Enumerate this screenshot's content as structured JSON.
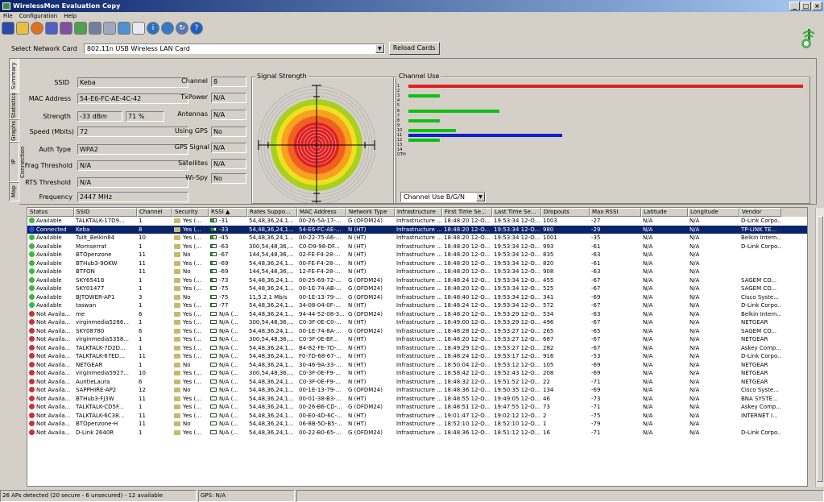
{
  "window": {
    "title": "WirelessMon Evaluation Copy"
  },
  "menu": [
    "File",
    "Configuration",
    "Help"
  ],
  "toolbar_icons": [
    "save-icon",
    "open-folder-icon",
    "record-icon",
    "network-icon",
    "network-alt-icon",
    "card-icon",
    "card-alt-icon",
    "document-icon",
    "filter-icon",
    "page-icon",
    "info-icon",
    "globe-icon",
    "refresh-icon",
    "help-icon"
  ],
  "network": {
    "label": "Select Network Card",
    "value": "802.11n USB Wireless LAN Card",
    "reload": "Reload Cards"
  },
  "side_tabs": [
    "Summary",
    "Statistics",
    "Graphs",
    "IP Connection",
    "Map"
  ],
  "summary": {
    "ssid_label": "SSID",
    "ssid": "Keba",
    "mac_label": "MAC Address",
    "mac": "54-E6-FC-AE-4C-42",
    "strength_label": "Strength",
    "strength_dbm": "-33 dBm",
    "strength_pct": "71 %",
    "speed_label": "Speed (Mbits)",
    "speed": "72",
    "auth_label": "Auth Type",
    "auth": "WPA2",
    "frag_label": "Frag Threshold",
    "frag": "N/A",
    "rts_label": "RTS Threshold",
    "rts": "N/A",
    "freq_label": "Frequency",
    "freq": "2447 MHz",
    "channel_label": "Channel",
    "channel": "8",
    "txpower_label": "TxPower",
    "txpower": "N/A",
    "antennas_label": "Antennas",
    "antennas": "N/A",
    "usinggps_label": "Using GPS",
    "usinggps": "No",
    "gpssignal_label": "GPS Signal",
    "gpssignal": "N/A",
    "satellites_label": "Satellites",
    "satellites": "N/A",
    "wispy_label": "Wi-Spy",
    "wispy": "No"
  },
  "signal": {
    "title": "Signal Strength"
  },
  "channel_use": {
    "title": "Channel Use",
    "select": "Channel Use B/G/N",
    "channels": [
      "1",
      "2",
      "3",
      "4",
      "5",
      "6",
      "7",
      "8",
      "9",
      "10",
      "11",
      "12",
      "13",
      "14",
      "OTH"
    ],
    "values": [
      100,
      0,
      8,
      0,
      0,
      23,
      0,
      8,
      0,
      12,
      39,
      8,
      0,
      0,
      0
    ],
    "colors": [
      "#e02020",
      "#10c010",
      "#10c010",
      "#10c010",
      "#10c010",
      "#10c010",
      "#10c010",
      "#10c010",
      "#10c010",
      "#10c010",
      "#1020d0",
      "#10c010",
      "#10c010",
      "#10c010",
      "#10c010"
    ]
  },
  "table": {
    "columns": [
      "Status",
      "SSID",
      "Channel",
      "Security",
      "RSSI",
      "Rates Suppo...",
      "MAC Address",
      "Network Type",
      "Infrastructure",
      "First Time Se...",
      "Last Time Se...",
      "Dropouts",
      "Max RSSI",
      "Latitude",
      "Longitude",
      "Vendor"
    ],
    "rows": [
      {
        "status": "Available",
        "dot": "#3cb83c",
        "ssid": "TALKTALK-17D9...",
        "ch": "1",
        "sec": "Yes (...",
        "rssi": "-31",
        "fill": 0.6,
        "rates": "54,48,36,24,1...",
        "mac": "00-26-5A-17-...",
        "net": "G (OFDM24)",
        "inf": "Infrastructure ...",
        "first": "18:48:20 12-O...",
        "last": "19:53:34 12-O...",
        "drop": "1003",
        "max": "-27",
        "lat": "N/A",
        "lon": "N/A",
        "vendor": "D-Link Corpo..."
      },
      {
        "status": "Connected",
        "dot": "#2050d0",
        "ssid": "Keba",
        "ch": "8",
        "sec": "Yes (...",
        "rssi": "-33",
        "fill": 0.6,
        "rates": "54,48,36,24,1...",
        "mac": "54-E6-FC-AE-...",
        "net": "N (HT)",
        "inf": "Infrastructure ...",
        "first": "18:48:20 12-O...",
        "last": "19:53:34 12-O...",
        "drop": "980",
        "max": "-29",
        "lat": "N/A",
        "lon": "N/A",
        "vendor": "TP-LINK TE...",
        "sel": true
      },
      {
        "status": "Available",
        "dot": "#3cb83c",
        "ssid": "Tuilt_Belkin84",
        "ch": "10",
        "sec": "Yes (...",
        "rssi": "-45",
        "fill": 0.5,
        "rates": "54,48,36,24,1...",
        "mac": "00-22-75-A6-...",
        "net": "N (HT)",
        "inf": "Infrastructure ...",
        "first": "18:48:20 12-O...",
        "last": "19:53:34 12-O...",
        "drop": "1001",
        "max": "-35",
        "lat": "N/A",
        "lon": "N/A",
        "vendor": "Belkin Intern..."
      },
      {
        "status": "Available",
        "dot": "#3cb83c",
        "ssid": "Mornserrat",
        "ch": "1",
        "sec": "Yes (...",
        "rssi": "-63",
        "fill": 0.3,
        "rates": "300,54,48,36,...",
        "mac": "C0-D9-98-DF...",
        "net": "N (HT)",
        "inf": "Infrastructure ...",
        "first": "18:48:20 12-O...",
        "last": "19:53:34 12-O...",
        "drop": "993",
        "max": "-61",
        "lat": "N/A",
        "lon": "N/A",
        "vendor": "D-Link Corpo..."
      },
      {
        "status": "Available",
        "dot": "#3cb83c",
        "ssid": "BTOpenzone",
        "ch": "11",
        "sec": "No",
        "rssi": "-67",
        "fill": 0.3,
        "rates": "144,54,48,36,...",
        "mac": "02-FE-F4-28-...",
        "net": "N (HT)",
        "inf": "Infrastructure ...",
        "first": "18:48:20 12-O...",
        "last": "19:53:34 12-O...",
        "drop": "835",
        "max": "-63",
        "lat": "N/A",
        "lon": "N/A",
        "vendor": ""
      },
      {
        "status": "Available",
        "dot": "#3cb83c",
        "ssid": "BTHub3-9OKW",
        "ch": "11",
        "sec": "Yes (...",
        "rssi": "-69",
        "fill": 0.3,
        "rates": "54,48,36,24,1...",
        "mac": "00-FE-F4-28-...",
        "net": "N (HT)",
        "inf": "Infrastructure ...",
        "first": "18:48:20 12-O...",
        "last": "19:53:34 12-O...",
        "drop": "820",
        "max": "-61",
        "lat": "N/A",
        "lon": "N/A",
        "vendor": ""
      },
      {
        "status": "Available",
        "dot": "#3cb83c",
        "ssid": "BTFON",
        "ch": "11",
        "sec": "No",
        "rssi": "-69",
        "fill": 0.3,
        "rates": "144,54,48,36,...",
        "mac": "12-FE-F4-28-...",
        "net": "N (HT)",
        "inf": "Infrastructure ...",
        "first": "18:48:20 12-O...",
        "last": "19:53:34 12-O...",
        "drop": "908",
        "max": "-63",
        "lat": "N/A",
        "lon": "N/A",
        "vendor": ""
      },
      {
        "status": "Available",
        "dot": "#3cb83c",
        "ssid": "SKY65418",
        "ch": "1",
        "sec": "Yes (...",
        "rssi": "-73",
        "fill": 0.25,
        "rates": "54,48,36,24,1...",
        "mac": "00-25-69-72-...",
        "net": "G (OFDM24)",
        "inf": "Infrastructure ...",
        "first": "18:48:24 12-O...",
        "last": "19:53:34 12-O...",
        "drop": "455",
        "max": "-67",
        "lat": "N/A",
        "lon": "N/A",
        "vendor": "SAGEM CO..."
      },
      {
        "status": "Available",
        "dot": "#3cb83c",
        "ssid": "SKY01477",
        "ch": "1",
        "sec": "Yes (...",
        "rssi": "-75",
        "fill": 0.2,
        "rates": "54,48,36,24,1...",
        "mac": "00-1E-74-AB-...",
        "net": "G (OFDM24)",
        "inf": "Infrastructure ...",
        "first": "18:48:20 12-O...",
        "last": "19:53:34 12-O...",
        "drop": "525",
        "max": "-67",
        "lat": "N/A",
        "lon": "N/A",
        "vendor": "SAGEM CO..."
      },
      {
        "status": "Available",
        "dot": "#3cb83c",
        "ssid": "BJTOWER-AP1",
        "ch": "3",
        "sec": "No",
        "rssi": "-75",
        "fill": 0.2,
        "rates": "11,5.2,1 Mb/s",
        "mac": "00-1E-13-79-...",
        "net": "G (OFDM24)",
        "inf": "Infrastructure ...",
        "first": "18:48:40 12-O...",
        "last": "19:53:34 12-O...",
        "drop": "341",
        "max": "-69",
        "lat": "N/A",
        "lon": "N/A",
        "vendor": "Cisco Syste..."
      },
      {
        "status": "Available",
        "dot": "#3cb83c",
        "ssid": "taswan",
        "ch": "1",
        "sec": "Yes (...",
        "rssi": "-77",
        "fill": 0.15,
        "rates": "54,48,36,24,1...",
        "mac": "34-08-04-0F-...",
        "net": "N (HT)",
        "inf": "Infrastructure ...",
        "first": "18:48:24 12-O...",
        "last": "19:53:34 12-O...",
        "drop": "572",
        "max": "-67",
        "lat": "N/A",
        "lon": "N/A",
        "vendor": "D-Link Corpo..."
      },
      {
        "status": "Not Availa...",
        "dot": "#d03030",
        "ssid": "me",
        "ch": "6",
        "sec": "Yes (...",
        "rssi": "N/A (...",
        "fill": 0,
        "rates": "54,48,36,24,1...",
        "mac": "94-44-52-08-3...",
        "net": "G (OFDM24)",
        "inf": "Infrastructure ...",
        "first": "18:48:20 12-O...",
        "last": "19:53:29 12-O...",
        "drop": "534",
        "max": "-63",
        "lat": "N/A",
        "lon": "N/A",
        "vendor": "Belkin Intern..."
      },
      {
        "status": "Not Availa...",
        "dot": "#d03030",
        "ssid": "virginmedia5286...",
        "ch": "1",
        "sec": "Yes (...",
        "rssi": "N/A (...",
        "fill": 0,
        "rates": "300,54,48,36,...",
        "mac": "C0-3F-0E-C0-...",
        "net": "N (HT)",
        "inf": "Infrastructure ...",
        "first": "18:49:00 12-O...",
        "last": "19:53:29 12-O...",
        "drop": "496",
        "max": "-67",
        "lat": "N/A",
        "lon": "N/A",
        "vendor": "NETGEAR"
      },
      {
        "status": "Not Availa...",
        "dot": "#d03030",
        "ssid": "SKY08780",
        "ch": "6",
        "sec": "Yes (...",
        "rssi": "N/A (...",
        "fill": 0,
        "rates": "54,48,36,24,1...",
        "mac": "00-1E-74-8A-...",
        "net": "G (OFDM24)",
        "inf": "Infrastructure ...",
        "first": "18:48:28 12-O...",
        "last": "19:53:27 12-O...",
        "drop": "265",
        "max": "-65",
        "lat": "N/A",
        "lon": "N/A",
        "vendor": "SAGEM CO..."
      },
      {
        "status": "Not Availa...",
        "dot": "#d03030",
        "ssid": "virginmedia5358...",
        "ch": "1",
        "sec": "Yes (...",
        "rssi": "N/A (...",
        "fill": 0,
        "rates": "300,54,48,36,...",
        "mac": "C0-3F-0E-BF...",
        "net": "N (HT)",
        "inf": "Infrastructure ...",
        "first": "18:48:20 12-O...",
        "last": "19:53:27 12-O...",
        "drop": "687",
        "max": "-67",
        "lat": "N/A",
        "lon": "N/A",
        "vendor": "NETGEAR"
      },
      {
        "status": "Not Availa...",
        "dot": "#d03030",
        "ssid": "TALKTALK-7D2D...",
        "ch": "1",
        "sec": "Yes (...",
        "rssi": "N/A (...",
        "fill": 0,
        "rates": "54,48,36,24,1...",
        "mac": "B4-82-FE-7D-...",
        "net": "N (HT)",
        "inf": "Infrastructure ...",
        "first": "18:49:29 12-O...",
        "last": "19:53:27 12-O...",
        "drop": "282",
        "max": "-67",
        "lat": "N/A",
        "lon": "N/A",
        "vendor": "Askey Comp..."
      },
      {
        "status": "Not Availa...",
        "dot": "#d03030",
        "ssid": "TALKTALK-67ED...",
        "ch": "11",
        "sec": "Yes (...",
        "rssi": "N/A (...",
        "fill": 0,
        "rates": "54,48,36,24,1...",
        "mac": "F0-7D-68-67-...",
        "net": "N (HT)",
        "inf": "Infrastructure ...",
        "first": "18:48:24 12-O...",
        "last": "19:53:17 12-O...",
        "drop": "916",
        "max": "-53",
        "lat": "N/A",
        "lon": "N/A",
        "vendor": "D-Link Corpo..."
      },
      {
        "status": "Not Availa...",
        "dot": "#d03030",
        "ssid": "NETGEAR",
        "ch": "1",
        "sec": "No",
        "rssi": "N/A (...",
        "fill": 0,
        "rates": "54,48,36,24,1...",
        "mac": "30-46-9A-33-...",
        "net": "N (HT)",
        "inf": "Infrastructure ...",
        "first": "18:50:04 12-O...",
        "last": "19:53:12 12-O...",
        "drop": "105",
        "max": "-69",
        "lat": "N/A",
        "lon": "N/A",
        "vendor": "NETGEAR"
      },
      {
        "status": "Not Availa...",
        "dot": "#d03030",
        "ssid": "virginmedia5927...",
        "ch": "10",
        "sec": "Yes (...",
        "rssi": "N/A (...",
        "fill": 0,
        "rates": "300,54,48,36,...",
        "mac": "C0-3F-0E-F9-...",
        "net": "N (HT)",
        "inf": "Infrastructure ...",
        "first": "18:58:42 12-O...",
        "last": "19:52:43 12-O...",
        "drop": "208",
        "max": "-69",
        "lat": "N/A",
        "lon": "N/A",
        "vendor": "NETGEAR"
      },
      {
        "status": "Not Availa...",
        "dot": "#d03030",
        "ssid": "AuntieLaura",
        "ch": "6",
        "sec": "Yes (...",
        "rssi": "N/A (...",
        "fill": 0,
        "rates": "54,48,36,24,1...",
        "mac": "C0-3F-0E-F9-...",
        "net": "N (HT)",
        "inf": "Infrastructure ...",
        "first": "18:48:32 12-O...",
        "last": "19:51:52 12-O...",
        "drop": "22",
        "max": "-71",
        "lat": "N/A",
        "lon": "N/A",
        "vendor": "NETGEAR"
      },
      {
        "status": "Not Availa...",
        "dot": "#d03030",
        "ssid": "SAPPHIRE-AP2",
        "ch": "12",
        "sec": "No",
        "rssi": "N/A (...",
        "fill": 0,
        "rates": "54,48,36,24,1...",
        "mac": "00-1E-13-79-...",
        "net": "G (OFDM24)",
        "inf": "Infrastructure ...",
        "first": "18:48:36 12-O...",
        "last": "19:50:35 12-O...",
        "drop": "134",
        "max": "-69",
        "lat": "N/A",
        "lon": "N/A",
        "vendor": "Cisco Syste..."
      },
      {
        "status": "Not Availa...",
        "dot": "#d03030",
        "ssid": "BTHub3-FJ3W",
        "ch": "11",
        "sec": "Yes (...",
        "rssi": "N/A (...",
        "fill": 0,
        "rates": "54,48,36,24,1...",
        "mac": "00-01-38-B3-...",
        "net": "N (HT)",
        "inf": "Infrastructure ...",
        "first": "18:48:55 12-O...",
        "last": "19:49:05 12-O...",
        "drop": "46",
        "max": "-73",
        "lat": "N/A",
        "lon": "N/A",
        "vendor": "BNA SYSTE..."
      },
      {
        "status": "Not Availa...",
        "dot": "#d03030",
        "ssid": "TALKTALK-CD5F...",
        "ch": "1",
        "sec": "Yes (...",
        "rssi": "N/A (...",
        "fill": 0,
        "rates": "54,48,36,24,1...",
        "mac": "00-26-B6-CD-...",
        "net": "G (OFDM24)",
        "inf": "Infrastructure ...",
        "first": "18:48:51 12-O...",
        "last": "19:47:55 12-O...",
        "drop": "73",
        "max": "-71",
        "lat": "N/A",
        "lon": "N/A",
        "vendor": "Askey Comp..."
      },
      {
        "status": "Not Availa...",
        "dot": "#d03030",
        "ssid": "TALKTALK-6C38...",
        "ch": "11",
        "sec": "Yes (...",
        "rssi": "N/A (...",
        "fill": 0,
        "rates": "54,48,36,24,1...",
        "mac": "00-E0-4D-6C-...",
        "net": "N (HT)",
        "inf": "Infrastructure ...",
        "first": "19:01:47 12-O...",
        "last": "19:02:12 12-O...",
        "drop": "2",
        "max": "-75",
        "lat": "N/A",
        "lon": "N/A",
        "vendor": "INTERNET I..."
      },
      {
        "status": "Not Availa...",
        "dot": "#d03030",
        "ssid": "BTOpenzone-H",
        "ch": "11",
        "sec": "No",
        "rssi": "N/A (...",
        "fill": 0,
        "rates": "54,48,36,24,1...",
        "mac": "06-8B-5D-B5-...",
        "net": "N (HT)",
        "inf": "Infrastructure ...",
        "first": "18:52:10 12-O...",
        "last": "18:52:10 12-O...",
        "drop": "1",
        "max": "-79",
        "lat": "N/A",
        "lon": "N/A",
        "vendor": ""
      },
      {
        "status": "Not Availa...",
        "dot": "#d03030",
        "ssid": "D-Link 2640R",
        "ch": "1",
        "sec": "Yes (...",
        "rssi": "N/A (...",
        "fill": 0,
        "rates": "54,48,36,24,1...",
        "mac": "00-22-B0-65-...",
        "net": "G (OFDM24)",
        "inf": "Infrastructure ...",
        "first": "18:48:36 12-O...",
        "last": "18:51:12 12-O...",
        "drop": "16",
        "max": "-71",
        "lat": "N/A",
        "lon": "N/A",
        "vendor": "D-Link Corpo..."
      }
    ]
  },
  "status": {
    "aps": "26 APs detected (20 secure - 6 unsecured) - 12 available",
    "gps": "GPS: N/A"
  }
}
